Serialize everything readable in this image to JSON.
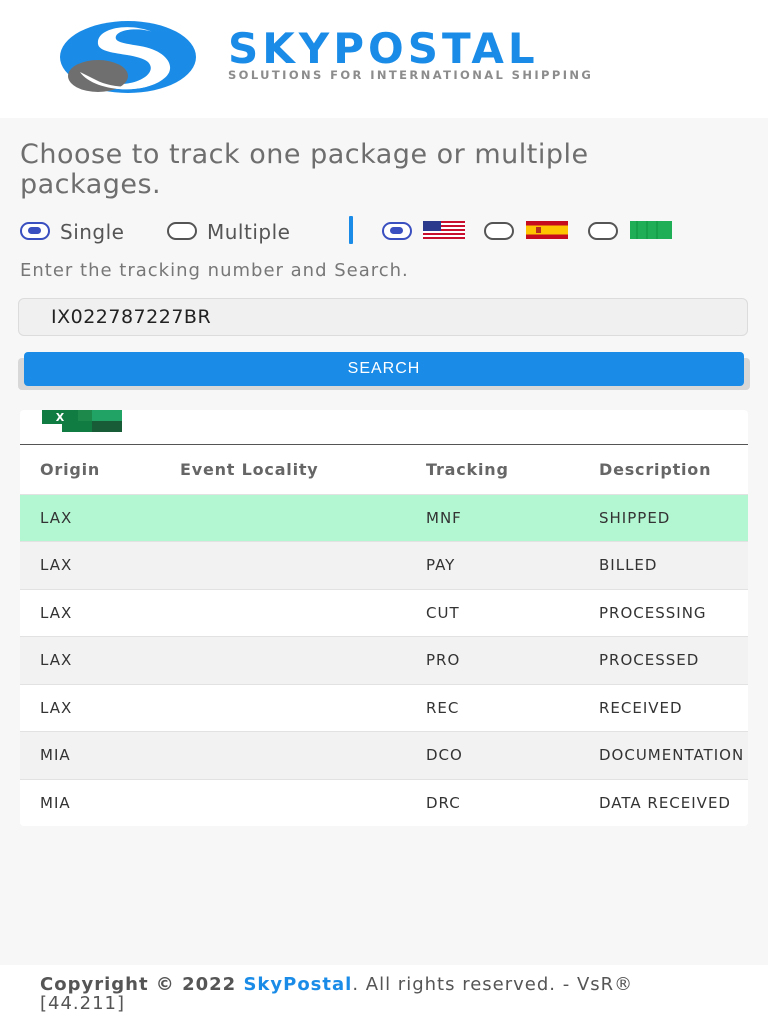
{
  "header": {
    "brand": "SKYPOSTAL",
    "tagline": "SOLUTIONS FOR INTERNATIONAL SHIPPING",
    "brand_color": "#1a8ce8"
  },
  "intro": "Choose to track one package or multiple packages.",
  "mode_options": [
    {
      "label": "Single",
      "selected": true
    },
    {
      "label": "Multiple",
      "selected": false
    }
  ],
  "languages": [
    {
      "icon": "us-flag-icon",
      "selected": true
    },
    {
      "icon": "spain-flag-icon",
      "selected": false
    },
    {
      "icon": "green-flag-icon",
      "selected": false
    }
  ],
  "hint": "Enter the tracking number and Search.",
  "search": {
    "value": "IX022787227BR"
  },
  "search_button": "SEARCH",
  "export_icon": "excel-icon",
  "table": {
    "columns": [
      "Origin",
      "Event Locality",
      "Tracking",
      "Description"
    ],
    "rows": [
      {
        "origin": "LAX",
        "locality": "",
        "tracking": "MNF",
        "description": "SHIPPED"
      },
      {
        "origin": "LAX",
        "locality": "",
        "tracking": "PAY",
        "description": "BILLED"
      },
      {
        "origin": "LAX",
        "locality": "",
        "tracking": "CUT",
        "description": "PROCESSING"
      },
      {
        "origin": "LAX",
        "locality": "",
        "tracking": "PRO",
        "description": "PROCESSED"
      },
      {
        "origin": "LAX",
        "locality": "",
        "tracking": "REC",
        "description": "RECEIVED"
      },
      {
        "origin": "MIA",
        "locality": "",
        "tracking": "DCO",
        "description": "DOCUMENTATION"
      },
      {
        "origin": "MIA",
        "locality": "",
        "tracking": "DRC",
        "description": "DATA RECEIVED"
      }
    ],
    "highlight_color": "#b3f7d2"
  },
  "footer": {
    "prefix": "Copyright © 2022 ",
    "link": "SkyPostal",
    "suffix": ". All rights reserved. - VsR® [44.211]"
  }
}
